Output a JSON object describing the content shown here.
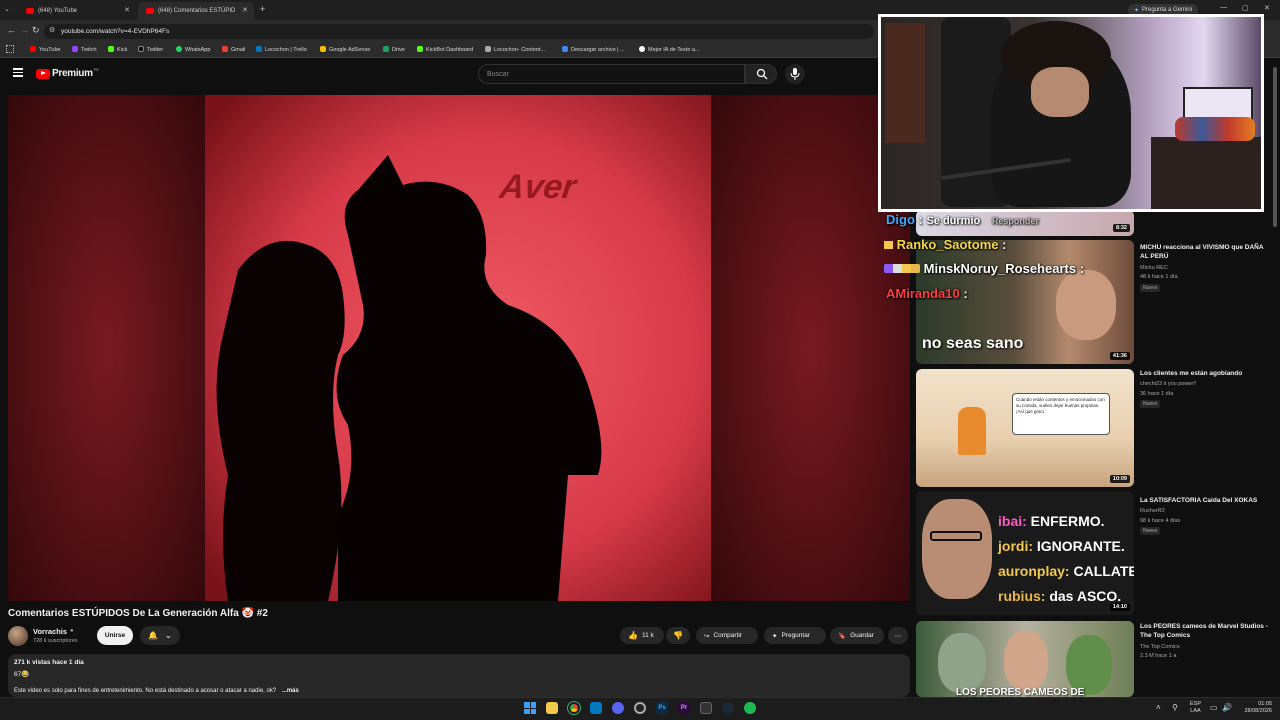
{
  "browser": {
    "tabs": [
      {
        "label": "(648) YouTube"
      },
      {
        "label": "(648) Comentarios ESTÚPID"
      }
    ],
    "url": "youtube.com/watch?v=4-EVDhP64Fs",
    "gemini_label": "Pregunta a Gemini",
    "bookmarks": [
      "YouTube",
      "Twitch",
      "Kick",
      "Twitter",
      "WhatsApp",
      "Gmail",
      "Locochon | Trello",
      "Google AdSense",
      "Drive",
      "KickBot Dashboard",
      "Locochon- Content...",
      "Descargar archivo | ...",
      "Mejor IA de Texto a..."
    ]
  },
  "youtube": {
    "logo_label": "Premium",
    "logo_superscript": "PE",
    "search_placeholder": "Buscar",
    "video_overlay_text": "Aver",
    "video_title": "Comentarios ESTÚPIDOS De La Generación Alfa 🤡 #2",
    "channel": {
      "name": "Vorrachis",
      "subscribers": "728 k suscriptores",
      "join_label": "Unirse"
    },
    "actions": {
      "likes": "11 k",
      "share": "Compartir",
      "ask": "Preguntar",
      "save": "Guardar",
      "more": "⋯"
    },
    "description": {
      "stats": "271 k vistas  hace 1 día",
      "emoji_line": "67😂",
      "text": "Este video es solo para fines de entretenimiento. No está destinado a acosar o atacar a nadie, ok?",
      "more": "...más"
    }
  },
  "chat_overlay": [
    {
      "user": "Digo",
      "message": "Se durmio",
      "reply": "Responder",
      "color": "#3ea6ff"
    },
    {
      "user": "Ranko_Saotome",
      "message": ":",
      "color": "#f7d64a"
    },
    {
      "user": "MinskNoruy_Rosehearts",
      "message": ":",
      "color": "#ffffff"
    },
    {
      "user": "AMiranda10",
      "message": ":",
      "color": "#ff3b3b"
    }
  ],
  "sidebar": {
    "videos": [
      {
        "title": "",
        "channel": "",
        "meta": "",
        "duration": "8:32"
      },
      {
        "title": "MICHU reacciona al VIVISMO que DAÑA AL PERÚ",
        "channel": "Michu REC",
        "meta": "48 k  hace 1 día",
        "badge": "Nuevo",
        "duration": "41:36",
        "thumb_text": "no seas sano"
      },
      {
        "title": "Los clientes me están agobiando",
        "channel": "chechi23 it you power!!",
        "meta": "36  hace 1 día",
        "badge": "Nuevo",
        "duration": "10:09",
        "thumb_text": "Cuando están contentos y emocionados con su comida, suelen dejar buenas propinas. ¡Así que graci"
      },
      {
        "title": "La SATISFACTORIA Caída Del XOKAS",
        "channel": "RusherR2",
        "meta": "98 k  hace 4 días",
        "badge": "Nuevo",
        "duration": "14:10",
        "thumb_lines": [
          {
            "name": "ibai:",
            "text": "ENFERMO."
          },
          {
            "name": "jordi:",
            "text": "IGNORANTE."
          },
          {
            "name": "auronplay:",
            "text": "CALLATE."
          },
          {
            "name": "rubius:",
            "text": "das ASCO."
          }
        ]
      },
      {
        "title": "Los PEORES cameos de Marvel Studios - The Top Comics",
        "channel": "The Top Comics",
        "meta": "2.3 M  hace 1 a",
        "thumb_text": "LOS PEORES CAMEOS DE"
      }
    ]
  },
  "taskbar": {
    "lang": "ESP",
    "lang_sub": "LAA",
    "time": "01:05",
    "date": "28/08/2026"
  },
  "colors": {
    "yt_red": "#ff0000",
    "video_red": "#e0434f",
    "bg": "#0f0f0f"
  }
}
